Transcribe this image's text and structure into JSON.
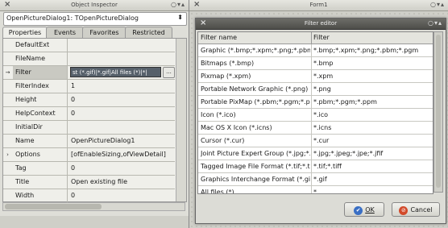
{
  "object_inspector": {
    "title": "Object Inspector",
    "component": "OpenPictureDialog1: TOpenPictureDialog",
    "tabs": [
      "Properties",
      "Events",
      "Favorites",
      "Restricted"
    ],
    "properties": [
      {
        "name": "DefaultExt",
        "value": "",
        "marker": ""
      },
      {
        "name": "FileName",
        "value": "",
        "marker": ""
      },
      {
        "name": "Filter",
        "value": "st (*.gif)|*.gif|All files (*)|*|",
        "marker": "→"
      },
      {
        "name": "FilterIndex",
        "value": "1",
        "marker": ""
      },
      {
        "name": "Height",
        "value": "0",
        "marker": ""
      },
      {
        "name": "HelpContext",
        "value": "0",
        "marker": ""
      },
      {
        "name": "InitialDir",
        "value": "",
        "marker": ""
      },
      {
        "name": "Name",
        "value": "OpenPictureDialog1",
        "marker": ""
      },
      {
        "name": "Options",
        "value": "[ofEnableSizing,ofViewDetail]",
        "marker": "›"
      },
      {
        "name": "Tag",
        "value": "0",
        "marker": ""
      },
      {
        "name": "Title",
        "value": "Open existing file",
        "marker": ""
      },
      {
        "name": "Width",
        "value": "0",
        "marker": ""
      }
    ],
    "ellipsis": "..."
  },
  "form1": {
    "title": "Form1"
  },
  "filter_editor": {
    "title": "Filter editor",
    "col_filter_name": "Filter name",
    "col_filter": "Filter",
    "rows": [
      {
        "name": "Graphic (*.bmp;*.xpm;*.png;*.pbm;*.pgm;*.ppm;*.ico;*.icns;*.cur;*.jpg;*.jpeg;*.jpe;*.jfif;*.tif;*.tiff;*.gif)",
        "filter": "*.bmp;*.xpm;*.png;*.pbm;*.pgm"
      },
      {
        "name": "Bitmaps (*.bmp)",
        "filter": "*.bmp"
      },
      {
        "name": "Pixmap (*.xpm)",
        "filter": "*.xpm"
      },
      {
        "name": "Portable Network Graphic (*.png)",
        "filter": "*.png"
      },
      {
        "name": "Portable PixMap (*.pbm;*.pgm;*.ppm)",
        "filter": "*.pbm;*.pgm;*.ppm"
      },
      {
        "name": "Icon (*.ico)",
        "filter": "*.ico"
      },
      {
        "name": "Mac OS X Icon (*.icns)",
        "filter": "*.icns"
      },
      {
        "name": "Cursor (*.cur)",
        "filter": "*.cur"
      },
      {
        "name": "Joint Picture Expert Group (*.jpg;*.jpeg;*.jpe;*.jfif)",
        "filter": "*.jpg;*.jpeg;*.jpe;*.jfif"
      },
      {
        "name": "Tagged Image File Format (*.tif;*.tiff)",
        "filter": "*.tif;*.tiff"
      },
      {
        "name": "Graphics Interchange Format (*.gif)",
        "filter": "*.gif"
      },
      {
        "name": "All files (*)",
        "filter": "*"
      },
      {
        "name": "",
        "filter": ""
      }
    ],
    "ok_label": "OK",
    "cancel_label": "Cancel",
    "ok_icon_color": "#3a6fc4",
    "cancel_icon_color": "#d24a2a"
  }
}
